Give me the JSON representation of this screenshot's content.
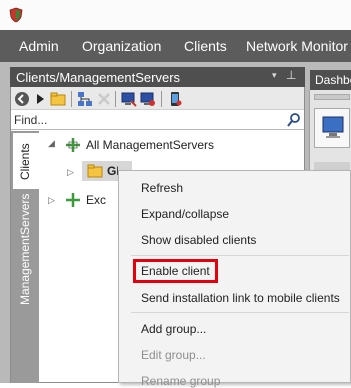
{
  "menubar": {
    "items": [
      "Admin",
      "Organization",
      "Clients",
      "Network Monitor"
    ]
  },
  "panel": {
    "title": "Clients/ManagementServers",
    "pin_down_glyph": "▾",
    "pin_glyph": "⊥",
    "find_placeholder": "Find..."
  },
  "vtabs": {
    "clients": "Clients",
    "management_servers": "ManagementServers"
  },
  "tree": {
    "root_label": "All ManagementServers",
    "child_label": "GDATATest",
    "other_label": "Exc"
  },
  "dashboard": {
    "tab_label": "Dashbo"
  },
  "context_menu": {
    "items": [
      {
        "label": "Refresh",
        "enabled": true
      },
      {
        "label": "Expand/collapse",
        "enabled": true
      },
      {
        "label": "Show disabled clients",
        "enabled": true
      },
      {
        "label": "Enable client",
        "enabled": true,
        "highlighted": true
      },
      {
        "label": "Send installation link to mobile clients",
        "enabled": true
      },
      {
        "label": "Add group...",
        "enabled": true
      },
      {
        "label": "Edit group...",
        "enabled": false
      },
      {
        "label": "Rename group",
        "enabled": false
      }
    ]
  },
  "colors": {
    "menubar": "#5c5c5c",
    "panel_header": "#4f4f4f",
    "highlight_box": "#e3000f"
  }
}
